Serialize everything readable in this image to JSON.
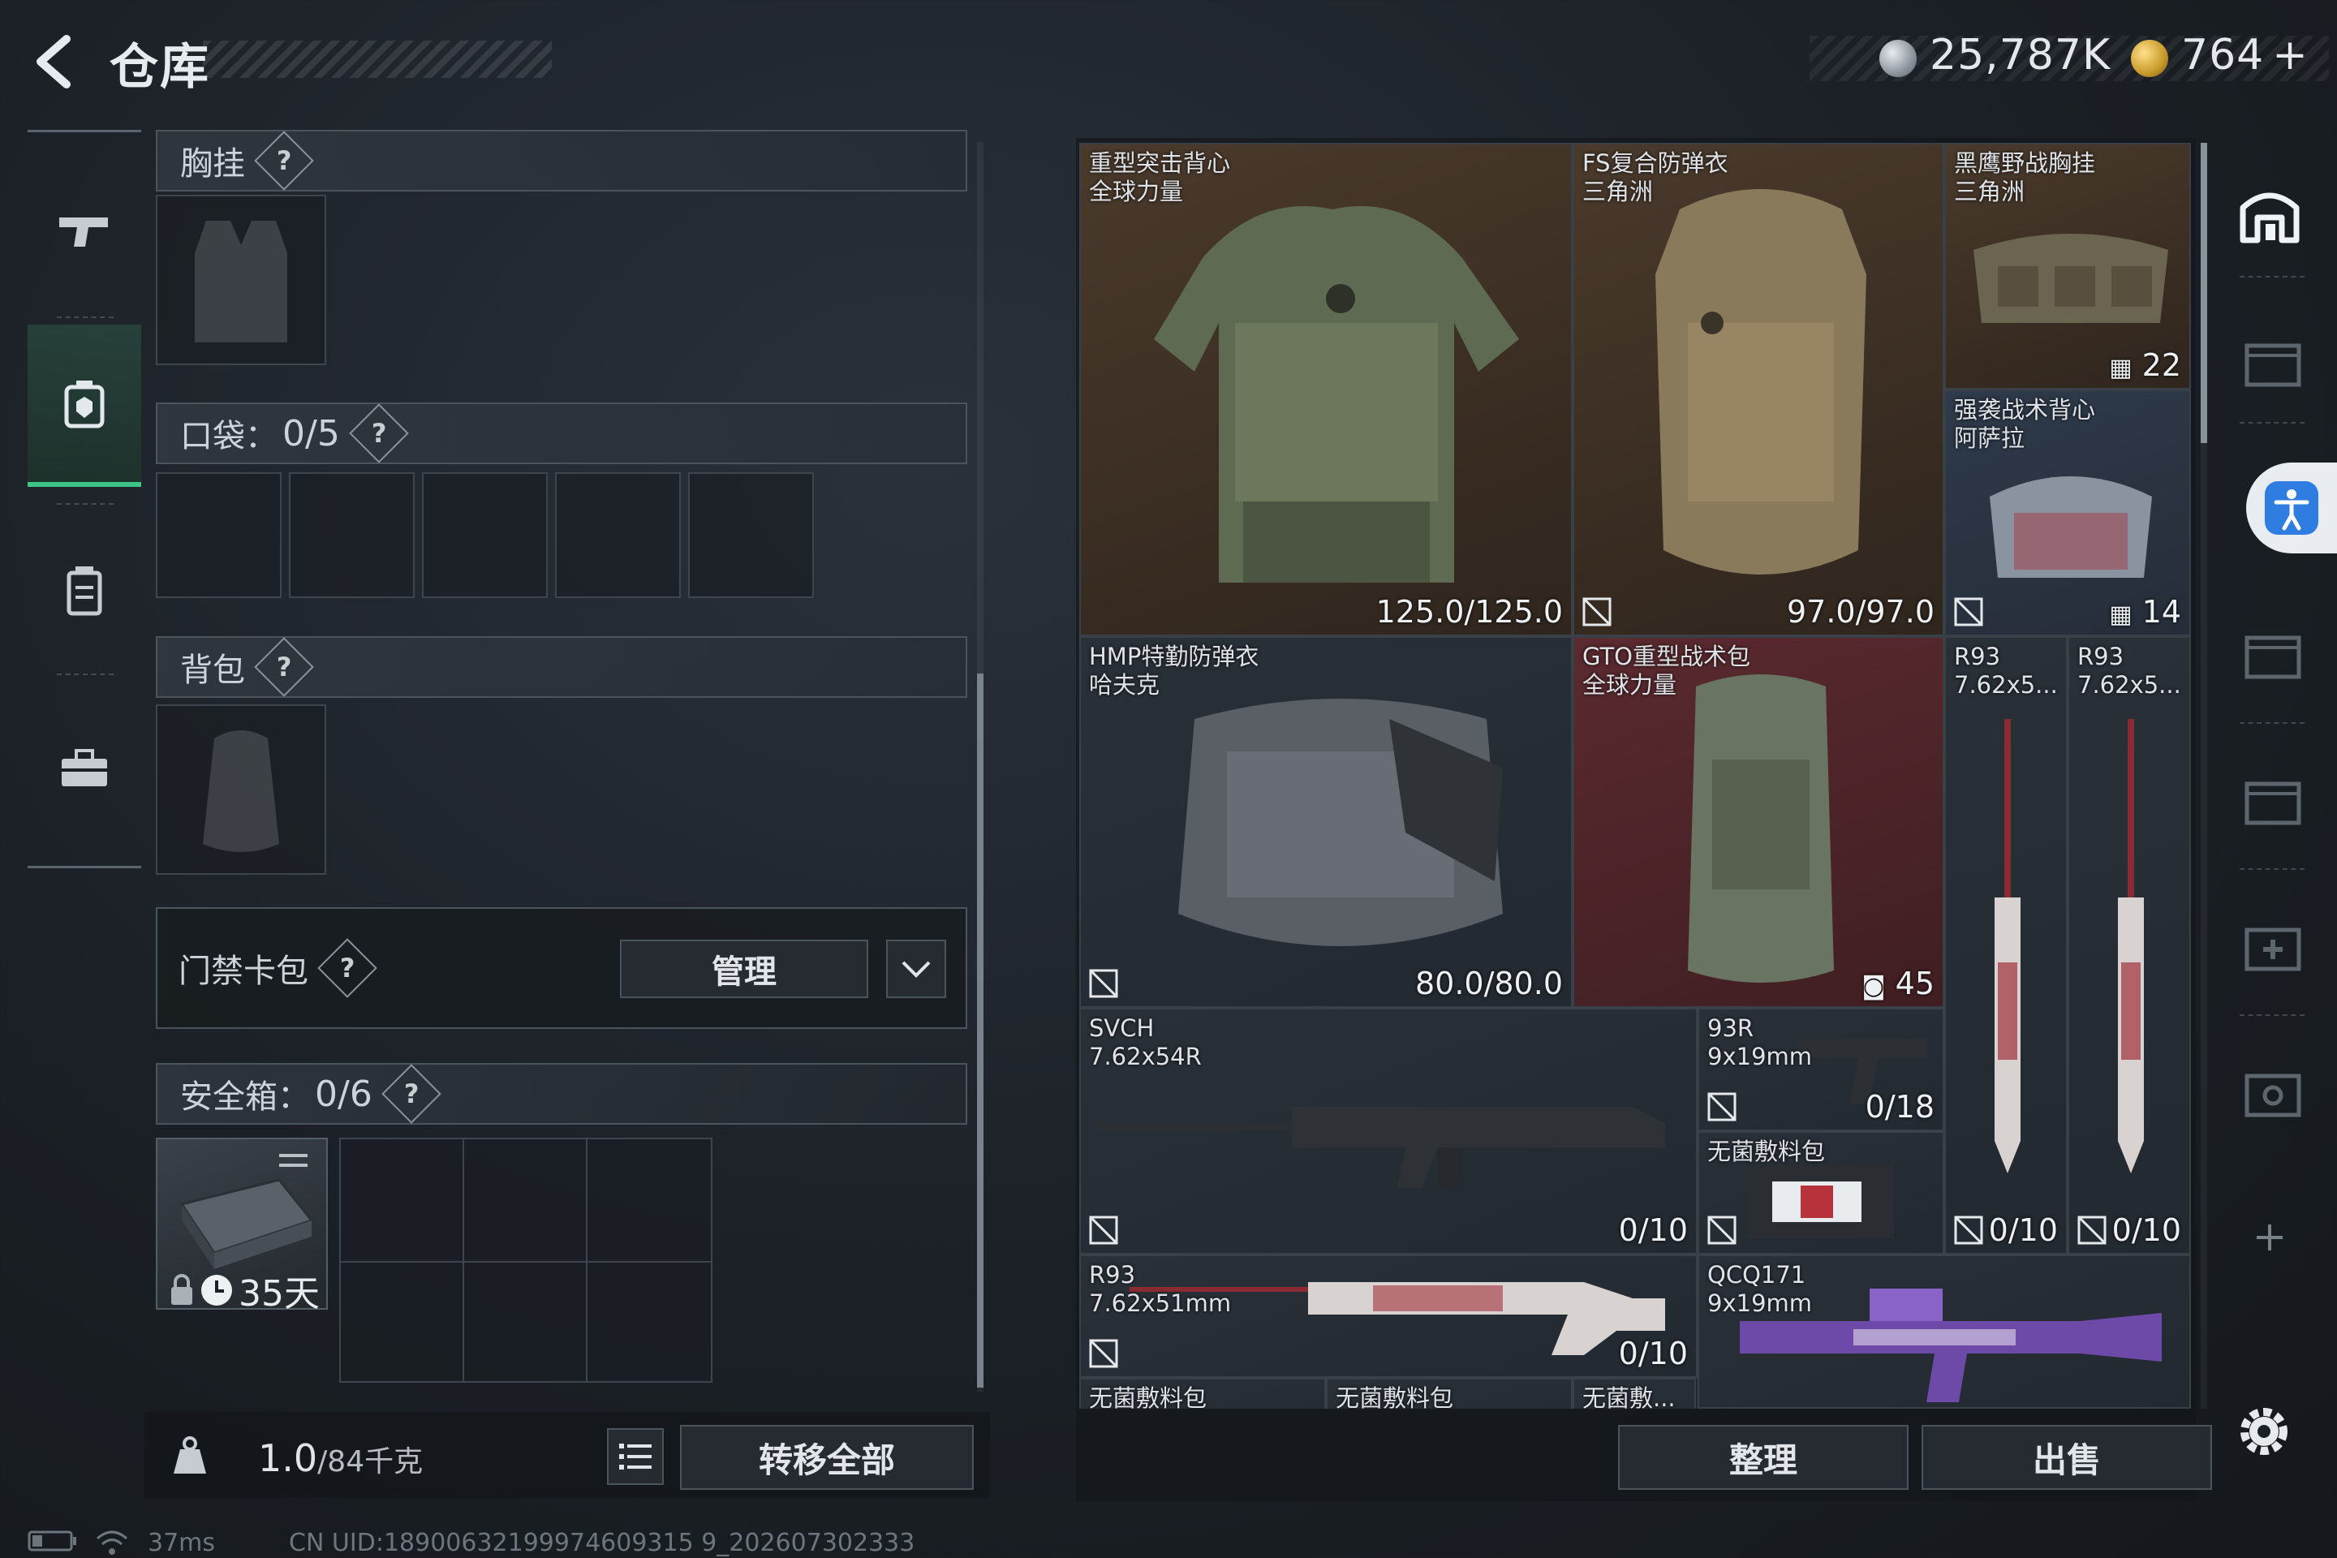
{
  "header": {
    "title": "仓库",
    "currency_silver": "25,787K",
    "currency_gold": "764",
    "currency_add": "+"
  },
  "equipment": {
    "chest_rig": {
      "label": "胸挂",
      "help": "?"
    },
    "pockets": {
      "label": "口袋：",
      "value": "0/5",
      "help": "?"
    },
    "backpack": {
      "label": "背包",
      "help": "?"
    },
    "keycard": {
      "label": "门禁卡包",
      "help": "?",
      "manage_label": "管理"
    },
    "safebox": {
      "label": "安全箱：",
      "value": "0/6",
      "help": "?",
      "days": "35天"
    }
  },
  "footer_left": {
    "weight_value": "1.0",
    "weight_max": "/84千克",
    "transfer_label": "转移全部"
  },
  "status": {
    "ping": "37ms",
    "uid": "CN UID:18900632199974609315 9_202607302333"
  },
  "inventory": {
    "items": [
      {
        "name1": "重型突击背心",
        "name2": "全球力量",
        "stat": "125.0/125.0"
      },
      {
        "name1": "FS复合防弹衣",
        "name2": "三角洲",
        "stat": "97.0/97.0"
      },
      {
        "name1": "黑鹰野战胸挂",
        "name2": "三角洲",
        "stat": "22"
      },
      {
        "name1": "强袭战术背心",
        "name2": "阿萨拉",
        "stat": "14"
      },
      {
        "name1": "HMP特勤防弹衣",
        "name2": "哈夫克",
        "stat": "80.0/80.0"
      },
      {
        "name1": "GTO重型战术包",
        "name2": "全球力量",
        "stat": "45"
      },
      {
        "name1": "R93",
        "name2": "7.62x5...",
        "stat": "0/10"
      },
      {
        "name1": "R93",
        "name2": "7.62x5...",
        "stat": "0/10"
      },
      {
        "name1": "SVCH",
        "name2": "7.62x54R",
        "stat": "0/10"
      },
      {
        "name1": "93R",
        "name2": "9x19mm",
        "stat": "0/18"
      },
      {
        "name1": "无菌敷料包",
        "name2": "",
        "stat": ""
      },
      {
        "name1": "R93",
        "name2": "7.62x51mm",
        "stat": "0/10"
      },
      {
        "name1": "QCQ171",
        "name2": "9x19mm",
        "stat": ""
      },
      {
        "name1": "无菌敷料包",
        "name2": "",
        "stat": ""
      },
      {
        "name1": "无菌敷料包",
        "name2": "",
        "stat": ""
      },
      {
        "name1": "无菌敷...",
        "name2": "",
        "stat": ""
      }
    ],
    "sort_label": "整理",
    "sell_label": "出售"
  },
  "colors": {
    "accent_green": "#3cc489",
    "accent_blue": "#2f7de1",
    "rarity_brown": "#4a3a2c",
    "rarity_red": "#5a2a2f"
  }
}
